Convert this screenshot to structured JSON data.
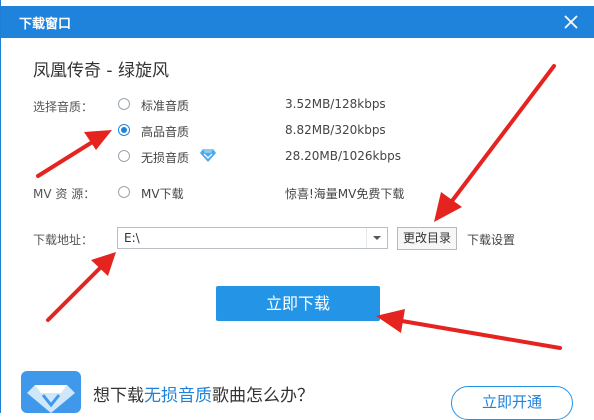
{
  "window": {
    "title": "下载窗口"
  },
  "song": {
    "title": "凤凰传奇 - 绿旋风"
  },
  "quality": {
    "label": "选择音质：",
    "options": [
      {
        "name": "标准音质",
        "size": "3.52MB/128kbps",
        "selected": false
      },
      {
        "name": "高品音质",
        "size": "8.82MB/320kbps",
        "selected": true
      },
      {
        "name": "无损音质",
        "size": "28.20MB/1026kbps",
        "selected": false
      }
    ]
  },
  "mv": {
    "label": "MV 资  源：",
    "option": "MV下载",
    "note": "惊喜!海量MV免费下载"
  },
  "path": {
    "label": "下载地址：",
    "value": "E:\\",
    "change_button": "更改目录",
    "settings_link": "下载设置"
  },
  "download_button": "立即下载",
  "promo": {
    "text_before": "想下载",
    "text_highlight": "无损音质",
    "text_after": "歌曲怎么办？",
    "button": "立即开通"
  },
  "colors": {
    "accent": "#1f83dc",
    "button": "#2494e6",
    "arrow": "#e52420",
    "vip_diamond": "#4aa8ee"
  }
}
